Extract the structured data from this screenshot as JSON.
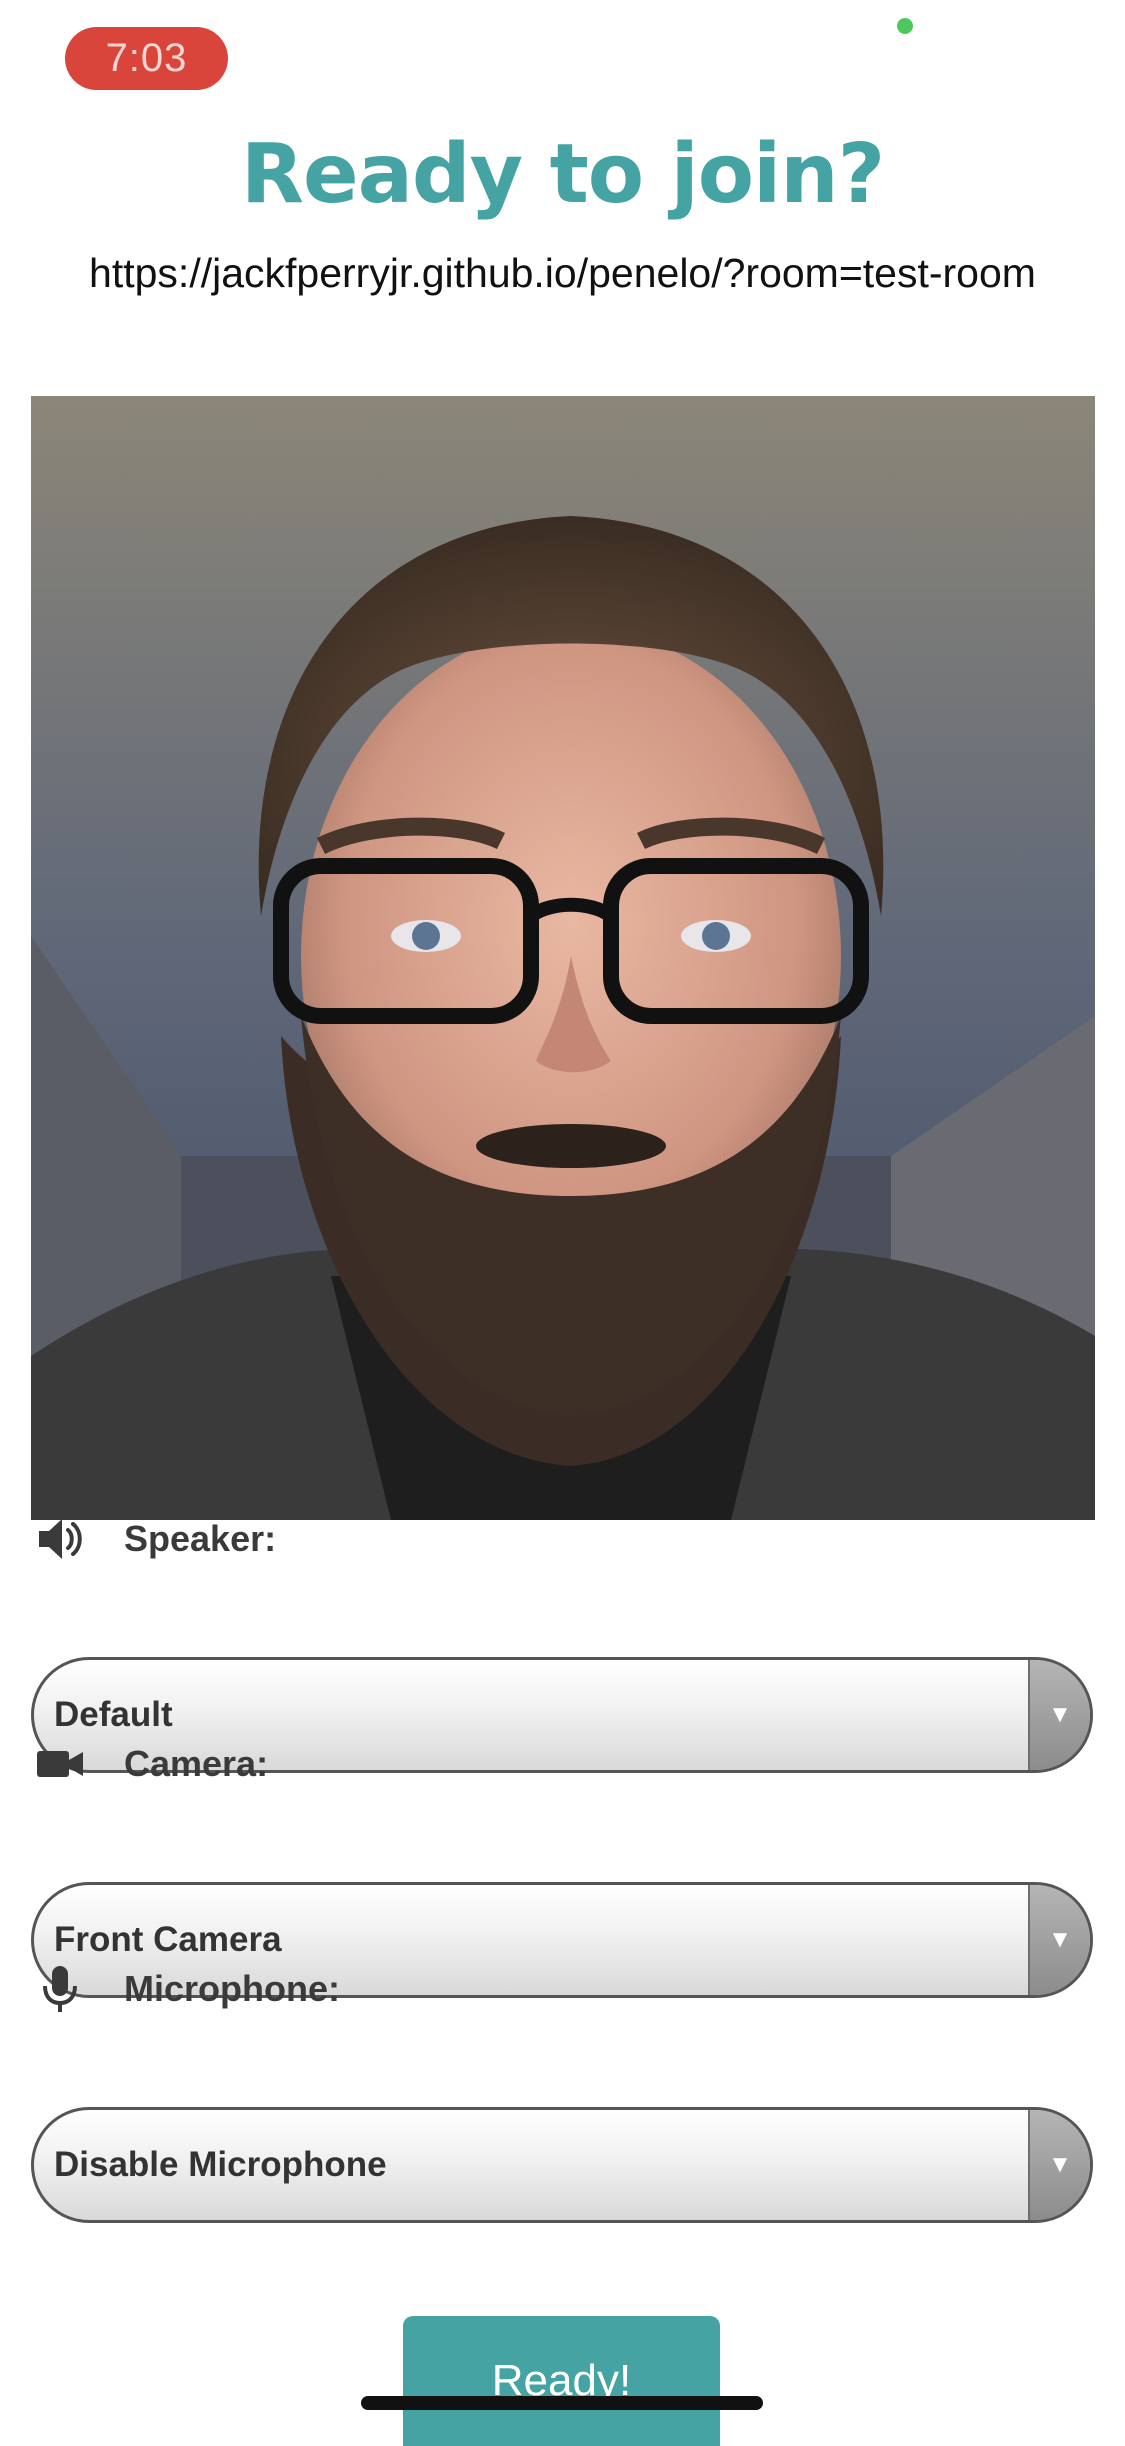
{
  "status_bar": {
    "time": "7:03"
  },
  "header": {
    "title": "Ready to join?",
    "room_url": "https://jackfperryjr.github.io/penelo/?room=test-room"
  },
  "devices": {
    "speaker": {
      "icon": "speaker-icon",
      "label": "Speaker:",
      "selected": "Default"
    },
    "camera": {
      "icon": "video-camera-icon",
      "label": "Camera:",
      "selected": "Front Camera"
    },
    "microphone": {
      "icon": "microphone-icon",
      "label": "Microphone:",
      "selected": "Disable Microphone"
    }
  },
  "actions": {
    "ready_label": "Ready!"
  },
  "colors": {
    "accent": "#45a3a3",
    "recording_pill": "#d9453a",
    "privacy_dot": "#4cc95a"
  }
}
